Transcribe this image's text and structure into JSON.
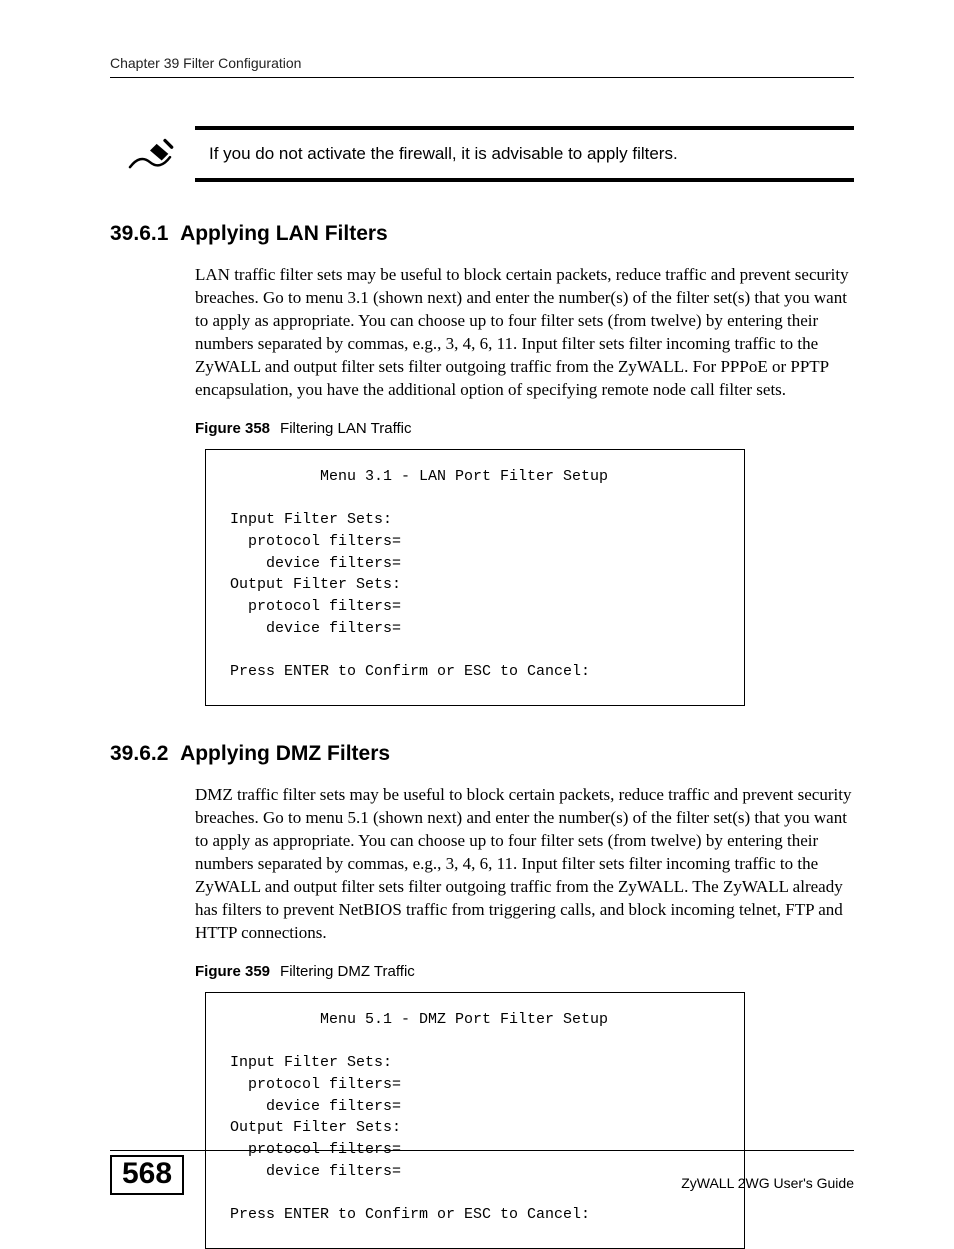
{
  "header": {
    "running_head": "Chapter 39 Filter Configuration"
  },
  "note": {
    "text": "If you do not activate the firewall, it is advisable to apply filters."
  },
  "section1": {
    "number": "39.6.1",
    "title": "Applying LAN Filters",
    "body": "LAN traffic filter sets may be useful to block certain packets, reduce traffic and prevent security breaches. Go to menu 3.1 (shown next) and enter the number(s) of the filter set(s) that you want to apply as appropriate. You can choose up to four filter sets (from twelve) by entering their numbers separated by commas, e.g., 3, 4, 6, 11. Input filter sets filter incoming traffic to the ZyWALL and output filter sets filter outgoing traffic from the ZyWALL. For PPPoE or PPTP encapsulation, you have the additional option of specifying remote node call filter sets.",
    "figure_label": "Figure 358",
    "figure_title": "Filtering LAN Traffic",
    "terminal": "          Menu 3.1 - LAN Port Filter Setup\n\nInput Filter Sets:\n  protocol filters=\n    device filters=\nOutput Filter Sets:\n  protocol filters=\n    device filters=\n\nPress ENTER to Confirm or ESC to Cancel:"
  },
  "section2": {
    "number": "39.6.2",
    "title": "Applying DMZ Filters",
    "body": "DMZ traffic filter sets may be useful to block certain packets, reduce traffic and prevent security breaches. Go to menu 5.1 (shown next) and enter the number(s) of the filter set(s) that you want to apply as appropriate. You can choose up to four filter sets (from twelve) by entering their numbers separated by commas, e.g., 3, 4, 6, 11. Input filter sets filter incoming traffic to the ZyWALL and output filter sets filter outgoing traffic from the ZyWALL. The ZyWALL already has filters to prevent NetBIOS traffic from triggering calls, and block incoming telnet, FTP and HTTP connections.",
    "figure_label": "Figure 359",
    "figure_title": "Filtering DMZ Traffic",
    "terminal": "          Menu 5.1 - DMZ Port Filter Setup\n\nInput Filter Sets:\n  protocol filters=\n    device filters=\nOutput Filter Sets:\n  protocol filters=\n    device filters=\n\nPress ENTER to Confirm or ESC to Cancel:"
  },
  "footer": {
    "page_number": "568",
    "guide_title": "ZyWALL 2WG User's Guide"
  }
}
